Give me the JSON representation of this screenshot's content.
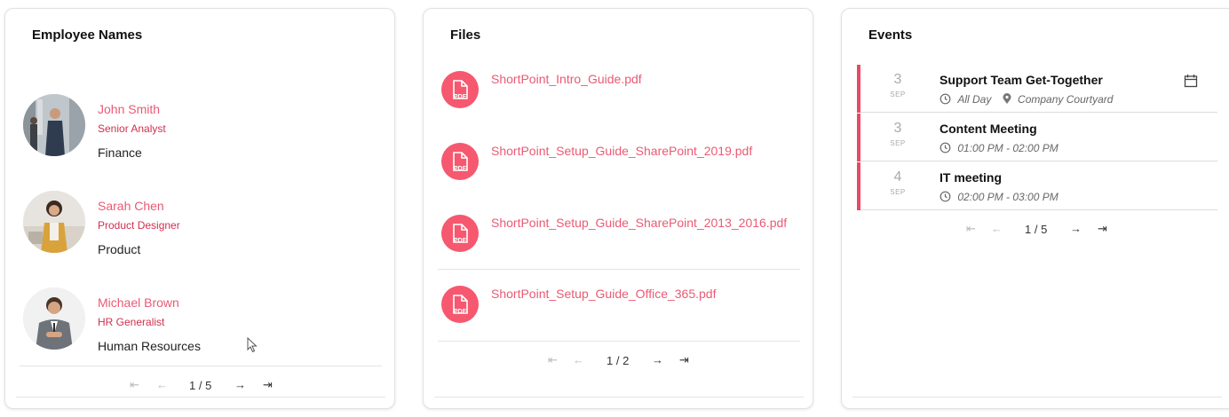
{
  "employees": {
    "title": "Employee Names",
    "items": [
      {
        "name": "John Smith",
        "role": "Senior Analyst",
        "dept": "Finance"
      },
      {
        "name": "Sarah Chen",
        "role": "Product Designer",
        "dept": "Product"
      },
      {
        "name": "Michael Brown",
        "role": "HR Generalist",
        "dept": "Human Resources"
      }
    ],
    "pager": {
      "text": "1 / 5"
    }
  },
  "files": {
    "title": "Files",
    "items": [
      {
        "name": "ShortPoint_Intro_Guide.pdf",
        "icon": "pdf-icon"
      },
      {
        "name": "ShortPoint_Setup_Guide_SharePoint_2019.pdf",
        "icon": "pdf-icon"
      },
      {
        "name": "ShortPoint_Setup_Guide_SharePoint_2013_2016.pdf",
        "icon": "pdf-icon"
      },
      {
        "name": "ShortPoint_Setup_Guide_Office_365.pdf",
        "icon": "pdf-icon"
      }
    ],
    "pager": {
      "text": "1 / 2"
    }
  },
  "events": {
    "title": "Events",
    "items": [
      {
        "day": "3",
        "month": "SEP",
        "title": "Support Team Get-Together",
        "time": "All Day",
        "location": "Company Courtyard"
      },
      {
        "day": "3",
        "month": "SEP",
        "title": "Content Meeting",
        "time": "01:00 PM - 02:00 PM"
      },
      {
        "day": "4",
        "month": "SEP",
        "title": "IT meeting",
        "time": "02:00 PM - 03:00 PM"
      }
    ],
    "pager": {
      "text": "1 / 5"
    }
  },
  "colors": {
    "accent": "#ea5a73",
    "role_red": "#d0304f",
    "pdf_badge": "#f5586f",
    "event_bar": "#ea4865"
  },
  "pager_icons": {
    "first": "⇤",
    "prev": "←",
    "next": "→",
    "last": "⇥"
  }
}
